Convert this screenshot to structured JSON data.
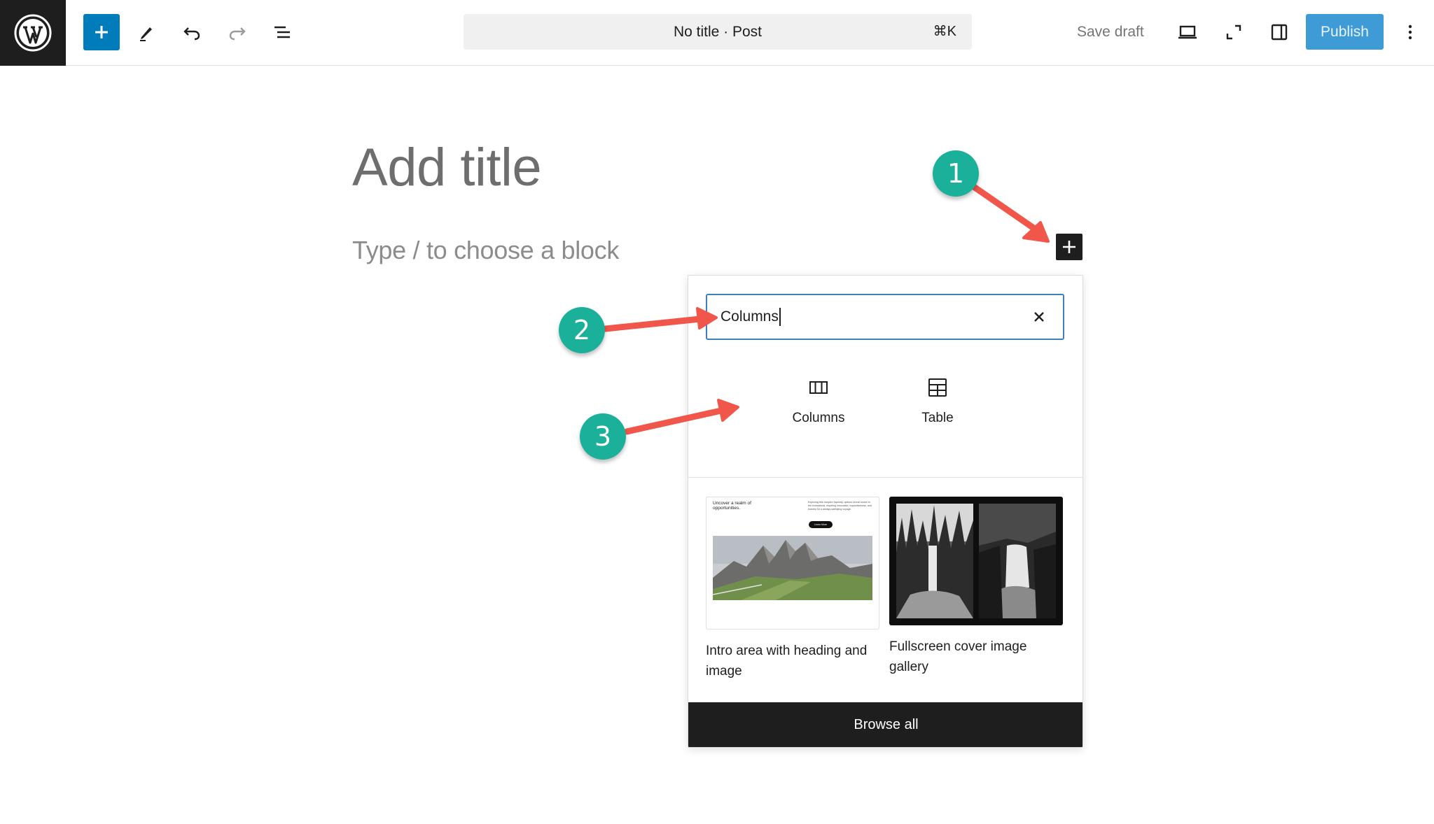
{
  "toolbar": {
    "logo_icon": "wordpress-logo-icon",
    "add_block_icon": "plus-icon",
    "tools_icon": "pencil-icon",
    "undo_icon": "undo-icon",
    "redo_icon": "redo-icon",
    "document_overview_icon": "list-view-icon",
    "document_title": "No title · Post",
    "command_shortcut": "⌘K",
    "save_draft_label": "Save draft",
    "preview_icon": "desktop-icon",
    "fullscreen_icon": "fullscreen-icon",
    "settings_icon": "sidebar-icon",
    "publish_label": "Publish",
    "options_icon": "more-vertical-icon",
    "accent_color": "#007cba",
    "publish_color": "#3e9bd6"
  },
  "editor": {
    "title_placeholder": "Add title",
    "block_placeholder": "Type / to choose a block",
    "inline_inserter_icon": "plus-icon"
  },
  "inserter": {
    "search_value": "Columns",
    "clear_icon": "close-icon",
    "blocks": [
      {
        "label": "Columns",
        "icon": "columns-icon"
      },
      {
        "label": "Table",
        "icon": "table-icon"
      }
    ],
    "patterns": [
      {
        "caption": "Intro area with heading and image",
        "preview_heading": "Uncover a realm of opportunities.",
        "preview_text": "Exploring this complex tapestry, options reveal routes to the exceptional, requiring innovation, inquisitiveness, and bravery for a always-satisfying voyage.",
        "preview_button": "Learn More"
      },
      {
        "caption": "Fullscreen cover image gallery"
      }
    ],
    "browse_all_label": "Browse all"
  },
  "annotations": {
    "callouts": [
      "1",
      "2",
      "3"
    ],
    "callout_color": "#1bb09a",
    "arrow_color": "#f0564a"
  }
}
